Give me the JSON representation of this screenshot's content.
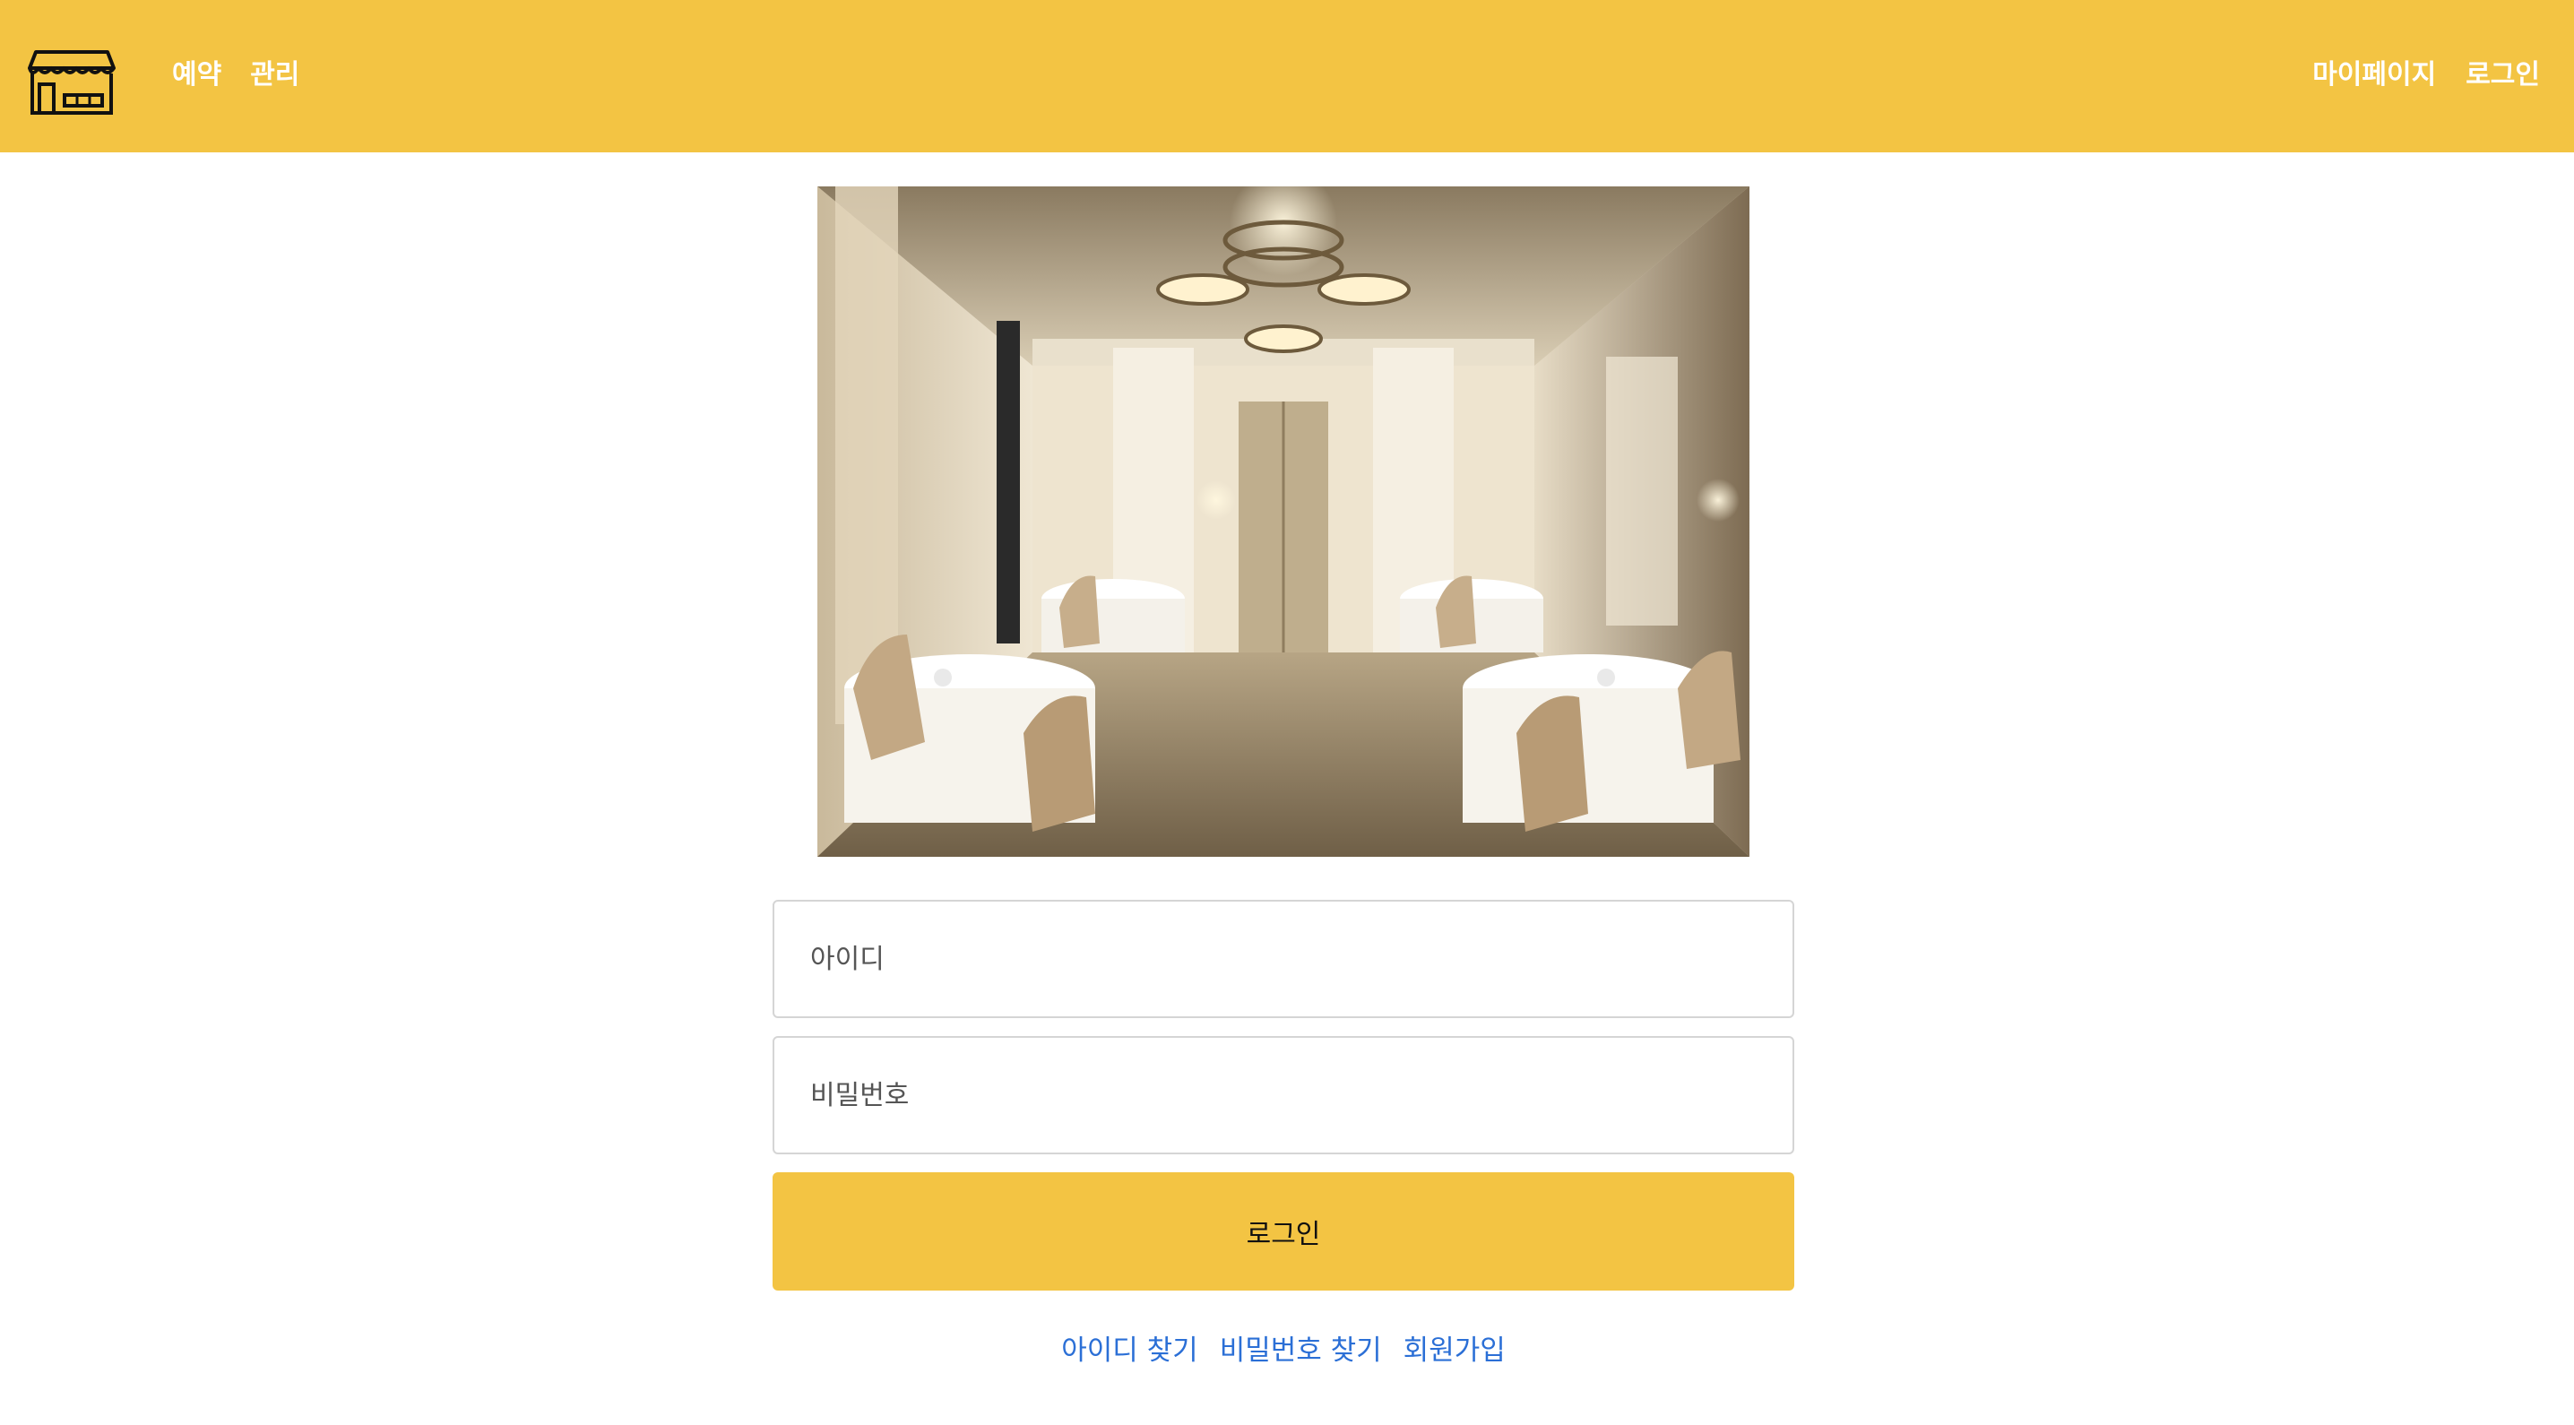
{
  "colors": {
    "brand": "#f3c443",
    "link": "#2b6fd6",
    "nav_text": "#ffffff"
  },
  "header": {
    "logo_icon": "storefront-icon",
    "nav_left": [
      "예약",
      "관리"
    ],
    "nav_right": [
      "마이페이지",
      "로그인"
    ]
  },
  "hero": {
    "image": "restaurant-dining-room-photo"
  },
  "form": {
    "id_placeholder": "아이디",
    "password_placeholder": "비밀번호",
    "login_label": "로그인"
  },
  "links": [
    "아이디 찾기",
    "비밀번호 찾기",
    "회원가입"
  ]
}
